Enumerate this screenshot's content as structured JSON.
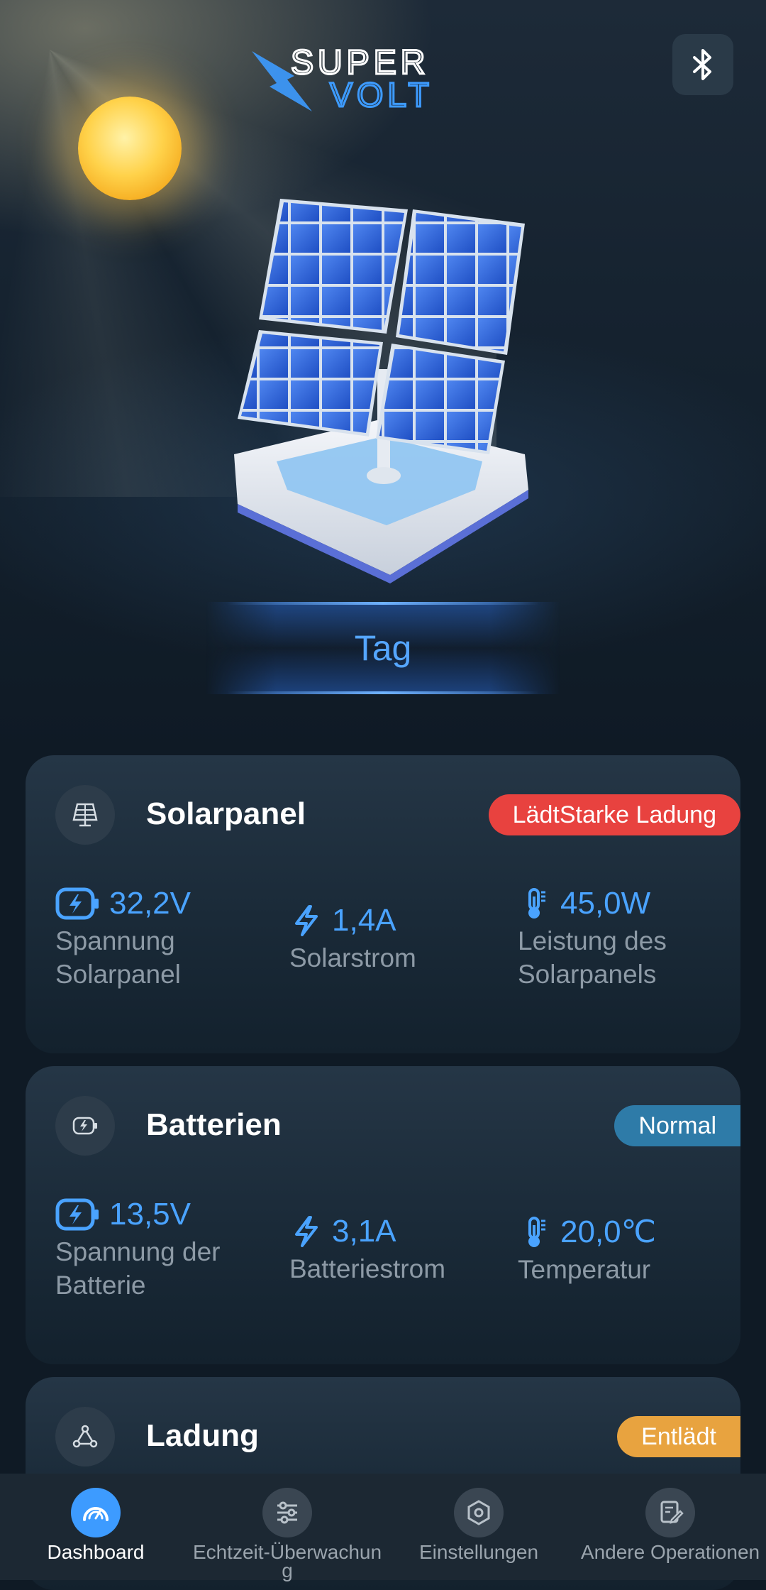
{
  "header": {
    "logo_top": "SUPER",
    "logo_bottom": "VOLT",
    "bluetooth_icon": "bluetooth-icon"
  },
  "hero": {
    "mode": "Tag"
  },
  "cards": {
    "solar": {
      "title": "Solarpanel",
      "icon": "solar-panel-icon",
      "badge": "LädtStarke Ladung",
      "badge_color": "#e8423f",
      "metrics": [
        {
          "icon": "battery-bolt-icon",
          "value": "32,2V",
          "label": "Spannung Solarpanel"
        },
        {
          "icon": "bolt-icon",
          "value": "1,4A",
          "label": "Solarstrom"
        },
        {
          "icon": "thermometer-icon",
          "value": "45,0W",
          "label": "Leistung des Solarpanels"
        }
      ]
    },
    "battery": {
      "title": "Batterien",
      "icon": "battery-icon",
      "badge": "Normal",
      "badge_color": "#2e7ba8",
      "metrics": [
        {
          "icon": "battery-bolt-icon",
          "value": "13,5V",
          "label": "Spannung der Batterie"
        },
        {
          "icon": "bolt-icon",
          "value": "3,1A",
          "label": "Batteriestrom"
        },
        {
          "icon": "thermometer-icon",
          "value": "20,0℃",
          "label": "Temperatur"
        }
      ]
    },
    "charge": {
      "title": "Ladung",
      "icon": "nodes-icon",
      "badge": "Entlädt",
      "badge_color": "#e8a33f"
    }
  },
  "nav": {
    "items": [
      {
        "label": "Dashboard",
        "icon": "gauge-icon",
        "active": true
      },
      {
        "label": "Echtzeit-Überwachung",
        "icon": "sliders-icon",
        "active": false
      },
      {
        "label": "Einstellungen",
        "icon": "hexagon-settings-icon",
        "active": false
      },
      {
        "label": "Andere Operationen",
        "icon": "document-edit-icon",
        "active": false
      }
    ]
  },
  "colors": {
    "accent": "#4aa3ff",
    "background": "#0f1a25",
    "card": "#1f2f3d"
  }
}
